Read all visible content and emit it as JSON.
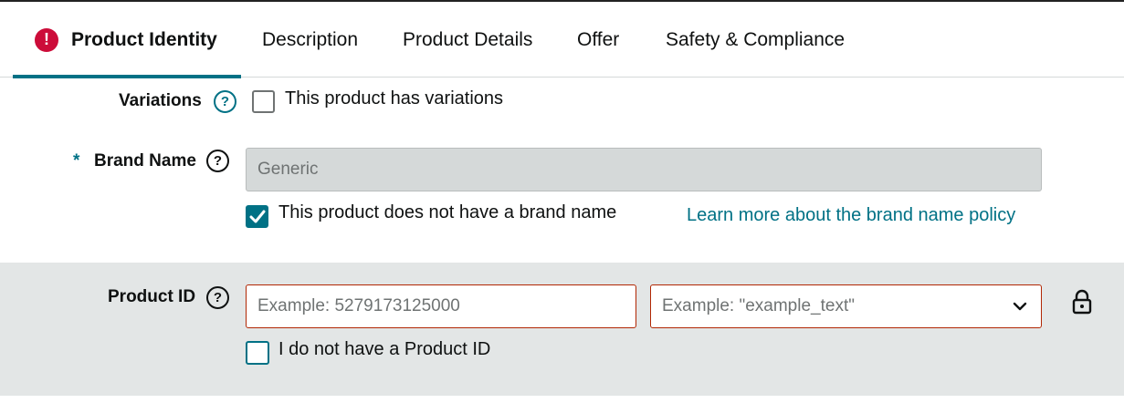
{
  "tabs": [
    {
      "label": "Product Identity",
      "active": true,
      "has_error": true
    },
    {
      "label": "Description"
    },
    {
      "label": "Product Details"
    },
    {
      "label": "Offer"
    },
    {
      "label": "Safety & Compliance"
    }
  ],
  "variations": {
    "label": "Variations",
    "checkbox_label": "This product has variations",
    "checked": false
  },
  "brand": {
    "required_mark": "*",
    "label": "Brand Name",
    "value": "Generic",
    "no_brand_label": "This product does not have a brand name",
    "no_brand_checked": true,
    "policy_link": "Learn more about the brand name policy"
  },
  "product_id": {
    "label": "Product ID",
    "id_placeholder": "Example: 5279173125000",
    "type_placeholder": "Example: \"example_text\"",
    "no_id_label": "I do not have a Product ID",
    "no_id_checked": false
  },
  "icons": {
    "error": "exclamation-circle-icon",
    "help": "question-circle-icon",
    "checkmark": "checkmark-icon",
    "chevron": "chevron-down-icon",
    "lock": "lock-icon"
  },
  "colors": {
    "accent": "#007185",
    "error": "#cc0c39",
    "error_border": "#b12704",
    "section_bg": "#e3e6e6"
  }
}
